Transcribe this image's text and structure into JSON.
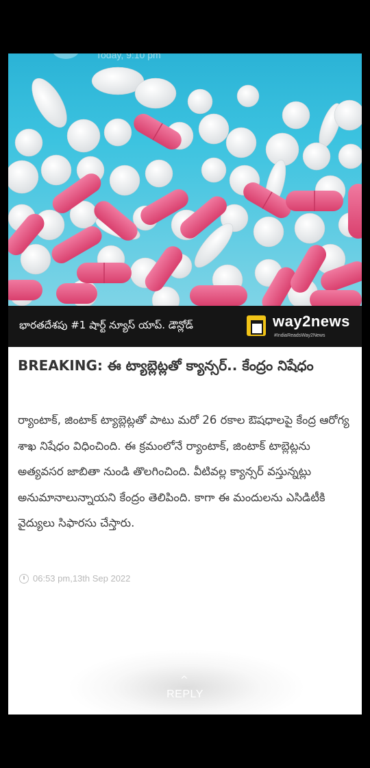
{
  "banner": {
    "text": "భారతదేశపు #1 షార్ట్ న్యూస్ యాప్. డౌన్లోడ్",
    "brand": "way2news",
    "tagline": "#IndiaReadsWay2News"
  },
  "hero": {
    "ghost_time": "Today, 9:10 pm"
  },
  "article": {
    "headline": "BREAKING: ఈ ట్యాబ్లెట్లతో క్యాన్సర్.. కేంద్రం నిషేధం",
    "body": "ర్యాంటాక్, జింటాక్ ట్యాబ్లెట్లతో పాటు మరో 26 రకాల ఔషధాలపై కేంద్ర ఆరోగ్య శాఖ నిషేధం విధించింది. ఈ క్రమంలోనే ర్యాంటాక్, జింటాక్ టాబ్లెట్లను అత్యవసర జాబితా నుండి తొలగించింది. వీటివల్ల క్యాన్సర్ వస్తున్నట్లు అనుమానాలున్నాయని కేంద్రం తెలిపింది. కాగా ఈ మందులను ఎసిడిటీకి వైద్యులు సిఫారసు చేస్తారు.",
    "timestamp": "06:53 pm,13th Sep 2022"
  },
  "reply": {
    "label": "REPLY",
    "chevron": "^"
  },
  "colors": {
    "background": "#000000",
    "banner": "#151515",
    "brand_yellow": "#f2c417",
    "pill_pink": "#e9547f",
    "sky": "#2bb3d6"
  }
}
